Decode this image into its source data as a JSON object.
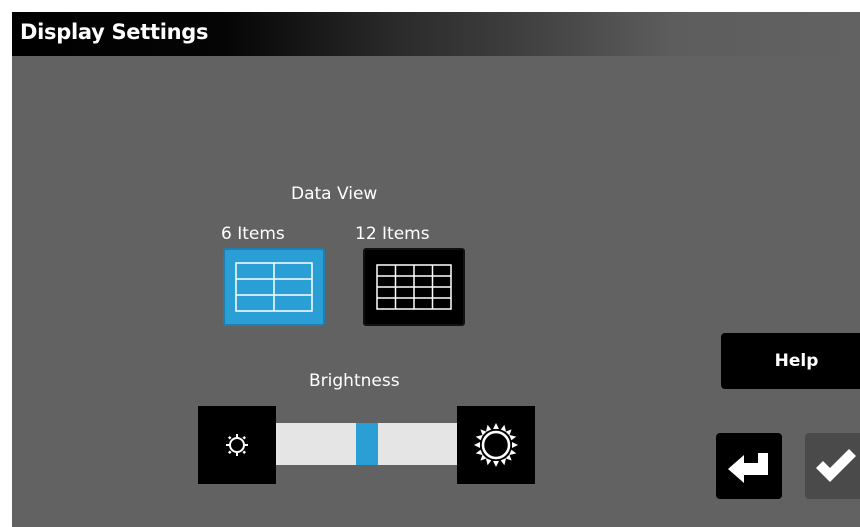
{
  "header": {
    "title": "Display Settings"
  },
  "data_view": {
    "label": "Data View",
    "options": [
      {
        "label": "6 Items",
        "selected": true
      },
      {
        "label": "12 Items",
        "selected": false
      }
    ]
  },
  "brightness": {
    "label": "Brightness",
    "level": 0.5,
    "decrease_icon": "sun-dim-icon",
    "increase_icon": "sun-bright-icon"
  },
  "actions": {
    "help_label": "Help",
    "back_icon": "return-arrow-icon",
    "ok_icon": "checkmark-icon"
  },
  "colors": {
    "accent": "#2a9fd6",
    "background": "#626262",
    "button": "#000000"
  }
}
